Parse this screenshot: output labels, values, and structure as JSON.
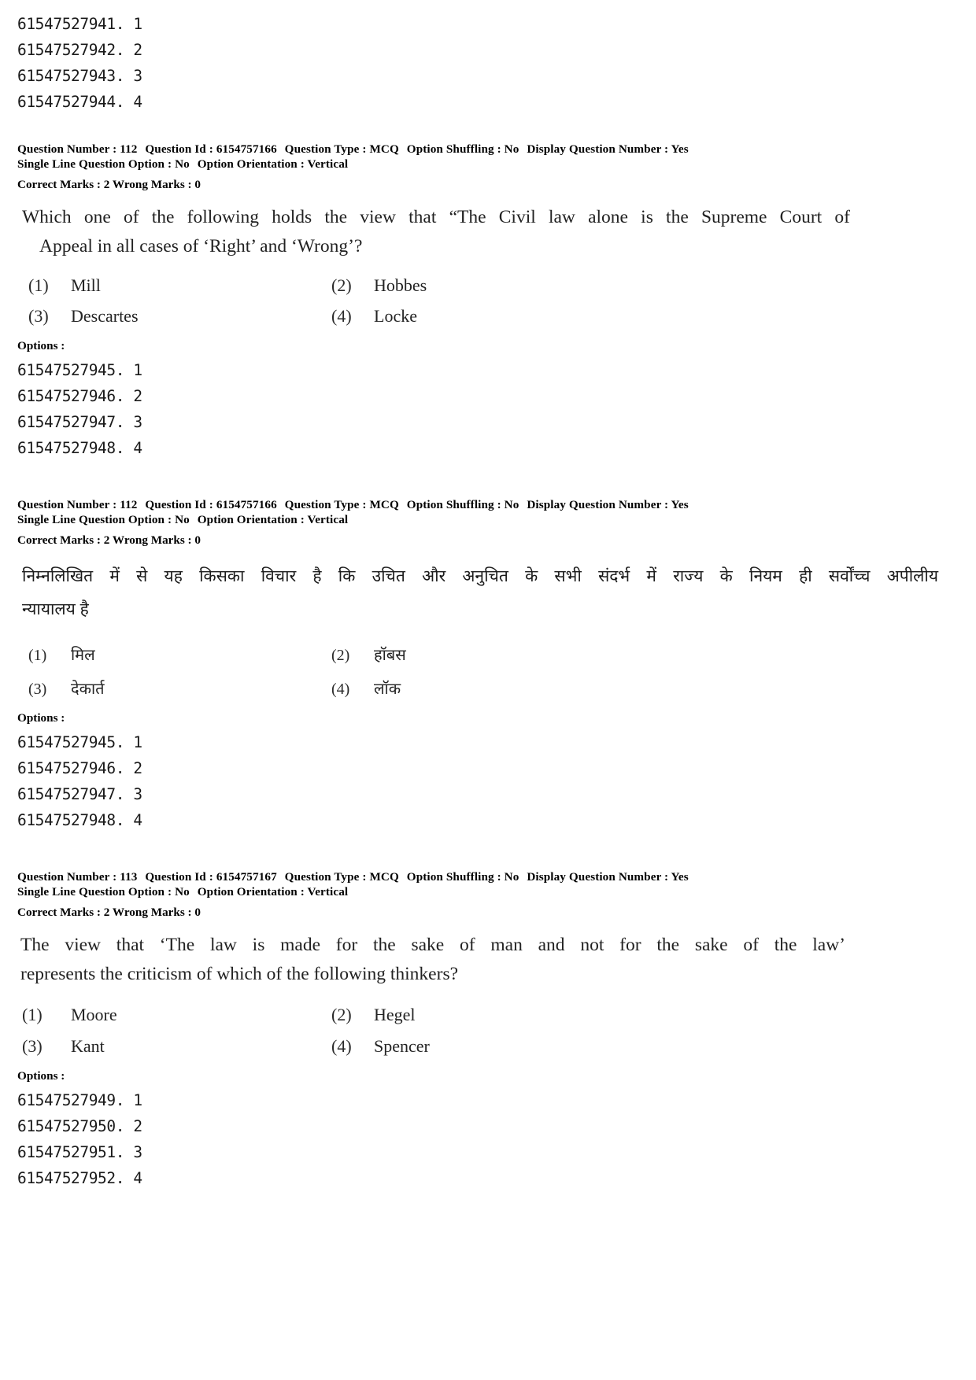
{
  "document": {
    "type": "exam-question-paper",
    "language_pairs": [
      "English",
      "Hindi"
    ]
  },
  "top_option_ids": [
    "61547527941. 1",
    "61547527942. 2",
    "61547527943. 3",
    "61547527944. 4"
  ],
  "questions": [
    {
      "id": "q112-en",
      "language": "English",
      "meta": {
        "question_number_label": "Question Number :",
        "question_number": "112",
        "question_id_label": "Question Id :",
        "question_id": "6154757166",
        "question_type_label": "Question Type :",
        "question_type": "MCQ",
        "option_shuffling_label": "Option Shuffling :",
        "option_shuffling": "No",
        "display_question_number_label": "Display Question Number :",
        "display_question_number": "Yes",
        "single_line_question_option_label": "Single Line Question Option :",
        "single_line_question_option": "No",
        "option_orientation_label": "Option Orientation :",
        "option_orientation": "Vertical",
        "correct_marks_label": "Correct Marks :",
        "correct_marks": "2",
        "wrong_marks_label": "Wrong Marks :",
        "wrong_marks": "0"
      },
      "stem_lines": [
        "Which one of the following holds the view that “The Civil law alone is the Supreme Court of",
        "Appeal in all cases of ‘Right’ and ‘Wrong’?"
      ],
      "choices": [
        {
          "num": "(1)",
          "text": "Mill"
        },
        {
          "num": "(2)",
          "text": "Hobbes"
        },
        {
          "num": "(3)",
          "text": "Descartes"
        },
        {
          "num": "(4)",
          "text": "Locke"
        }
      ],
      "options_label": "Options :",
      "option_ids": [
        "61547527945. 1",
        "61547527946. 2",
        "61547527947. 3",
        "61547527948. 4"
      ]
    },
    {
      "id": "q112-hi",
      "language": "Hindi",
      "meta": {
        "question_number_label": "Question Number :",
        "question_number": "112",
        "question_id_label": "Question Id :",
        "question_id": "6154757166",
        "question_type_label": "Question Type :",
        "question_type": "MCQ",
        "option_shuffling_label": "Option Shuffling :",
        "option_shuffling": "No",
        "display_question_number_label": "Display Question Number :",
        "display_question_number": "Yes",
        "single_line_question_option_label": "Single Line Question Option :",
        "single_line_question_option": "No",
        "option_orientation_label": "Option Orientation :",
        "option_orientation": "Vertical",
        "correct_marks_label": "Correct Marks :",
        "correct_marks": "2",
        "wrong_marks_label": "Wrong Marks :",
        "wrong_marks": "0"
      },
      "stem_lines": [
        "निम्नलिखित में से यह किसका विचार है कि उचित और अनुचित के सभी संदर्भ में राज्य के नियम ही सर्वोंच्च अपीलीय",
        "न्यायालय है"
      ],
      "choices": [
        {
          "num": "(1)",
          "text": "मिल"
        },
        {
          "num": "(2)",
          "text": "हॉबस"
        },
        {
          "num": "(3)",
          "text": "देकार्त"
        },
        {
          "num": "(4)",
          "text": "लॉक"
        }
      ],
      "options_label": "Options :",
      "option_ids": [
        "61547527945. 1",
        "61547527946. 2",
        "61547527947. 3",
        "61547527948. 4"
      ]
    },
    {
      "id": "q113-en",
      "language": "English",
      "meta": {
        "question_number_label": "Question Number :",
        "question_number": "113",
        "question_id_label": "Question Id :",
        "question_id": "6154757167",
        "question_type_label": "Question Type :",
        "question_type": "MCQ",
        "option_shuffling_label": "Option Shuffling :",
        "option_shuffling": "No",
        "display_question_number_label": "Display Question Number :",
        "display_question_number": "Yes",
        "single_line_question_option_label": "Single Line Question Option :",
        "single_line_question_option": "No",
        "option_orientation_label": "Option Orientation :",
        "option_orientation": "Vertical",
        "correct_marks_label": "Correct Marks :",
        "correct_marks": "2",
        "wrong_marks_label": "Wrong Marks :",
        "wrong_marks": "0"
      },
      "stem_lines": [
        "The view that ‘The law is made for the sake of man and not for the sake of the law’",
        "represents the criticism of which of the following thinkers?"
      ],
      "choices": [
        {
          "num": "(1)",
          "text": "Moore"
        },
        {
          "num": "(2)",
          "text": "Hegel"
        },
        {
          "num": "(3)",
          "text": "Kant"
        },
        {
          "num": "(4)",
          "text": "Spencer"
        }
      ],
      "options_label": "Options :",
      "option_ids": [
        "61547527949. 1",
        "61547527950. 2",
        "61547527951. 3",
        "61547527952. 4"
      ]
    }
  ]
}
